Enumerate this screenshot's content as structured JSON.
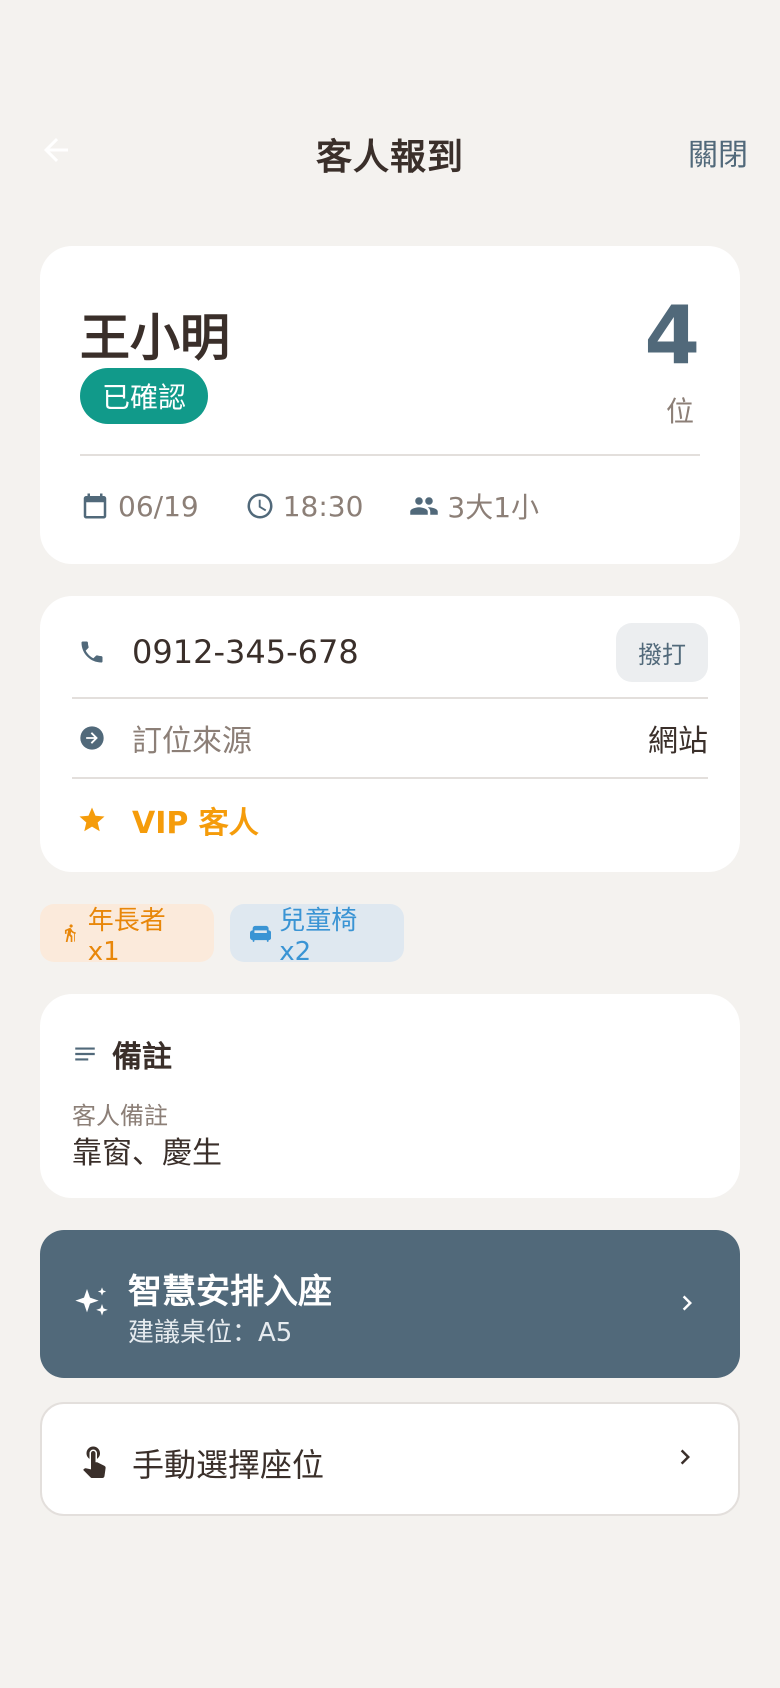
{
  "header": {
    "title": "客人報到",
    "close_label": "關閉"
  },
  "guest": {
    "name": "王小明",
    "status": "已確認",
    "party_size": "4",
    "party_unit": "位",
    "date": "06/19",
    "time": "18:30",
    "composition": "3大1小"
  },
  "contact": {
    "phone": "0912-345-678",
    "call_label": "撥打",
    "source_label": "訂位來源",
    "source_value": "網站",
    "vip_label": "VIP 客人"
  },
  "tags": [
    {
      "label": "年長者 x1",
      "icon": "elderly-icon"
    },
    {
      "label": "兒童椅 x2",
      "icon": "chair-icon"
    }
  ],
  "notes": {
    "title": "備註",
    "label": "客人備註",
    "value": "靠窗、慶生"
  },
  "smart_seat": {
    "title": "智慧安排入座",
    "subtitle": "建議桌位：A5"
  },
  "manual_seat": {
    "label": "手動選擇座位"
  },
  "colors": {
    "background": "#f4f2ef",
    "accent": "#51697a",
    "status_green": "#119a8a",
    "vip_orange": "#f59c0b",
    "chair_blue": "#3a94d4"
  }
}
